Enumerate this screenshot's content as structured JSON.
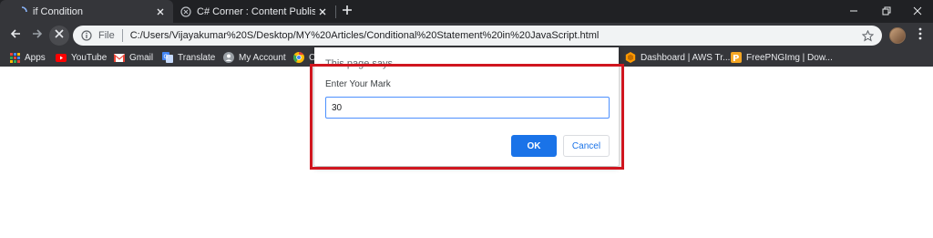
{
  "tabs": [
    {
      "title": "if Condition",
      "favicon": "page-loading-icon",
      "active": true
    },
    {
      "title": "C# Corner : Content Publisher",
      "favicon": "csharp-corner-icon",
      "active": false
    }
  ],
  "toolbar": {
    "scheme_label": "File",
    "url": "C:/Users/Vijayakumar%20S/Desktop/MY%20Articles/Conditional%20Statement%20in%20JavaScript.html"
  },
  "bookmarks": [
    {
      "label": "Apps",
      "icon": "apps-grid-icon",
      "color": "#e8eaed"
    },
    {
      "label": "YouTube",
      "icon": "youtube-icon",
      "color": "#ff0000"
    },
    {
      "label": "Gmail",
      "icon": "gmail-icon",
      "color": "#ea4335"
    },
    {
      "label": "Translate",
      "icon": "translate-icon",
      "color": "#4285f4"
    },
    {
      "label": "My Account",
      "icon": "account-icon",
      "color": "#5f6368"
    },
    {
      "label": "C",
      "icon": "chrome-icon",
      "color": "#fbbc05"
    },
    {
      "label": "Dashboard | AWS Tr...",
      "icon": "aws-icon",
      "color": "#ff9900"
    },
    {
      "label": "FreePNGImg | Dow...",
      "icon": "freepngimg-icon",
      "color": "#f5a623"
    }
  ],
  "dialog": {
    "header": "This page says",
    "message": "Enter Your Mark",
    "input_value": "30",
    "ok_label": "OK",
    "cancel_label": "Cancel"
  },
  "colors": {
    "tab_strip": "#202124",
    "toolbar": "#35363a",
    "accent": "#1a73e8",
    "highlight_border": "#d0161f"
  }
}
